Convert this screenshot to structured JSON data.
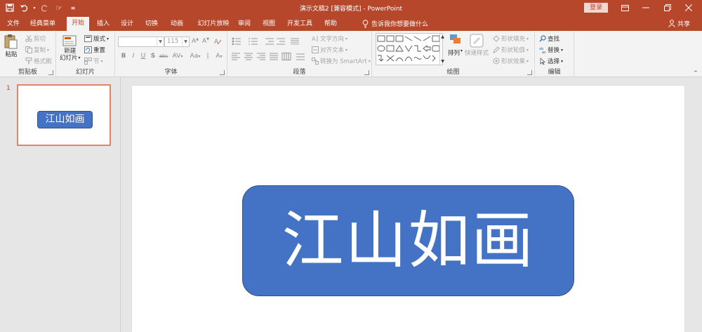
{
  "titlebar": {
    "doc_title": "演示文稿2 [兼容模式] - PowerPoint",
    "login": "登录",
    "qat_touch": "☞",
    "qat_more": "≡"
  },
  "tabs": [
    "文件",
    "经典菜单",
    "开始",
    "插入",
    "设计",
    "切换",
    "动画",
    "幻灯片放映",
    "审阅",
    "视图",
    "开发工具",
    "帮助"
  ],
  "tell_me": "告诉我你想要做什么",
  "share": "共享",
  "ribbon": {
    "clipboard": {
      "label": "剪贴板",
      "paste": "粘贴",
      "cut": "剪切",
      "copy": "复制",
      "format_painter": "格式刷"
    },
    "slides": {
      "label": "幻灯片",
      "new_slide_1": "新建",
      "new_slide_2": "幻灯片",
      "layout": "版式",
      "reset": "重置",
      "section": "节"
    },
    "font": {
      "label": "字体",
      "font_name": "",
      "font_size": "115"
    },
    "paragraph": {
      "label": "段落",
      "text_direction": "文字方向",
      "align_text": "对齐文本",
      "smartart": "转换为 SmartArt"
    },
    "drawing": {
      "label": "绘图",
      "arrange": "排列",
      "quick_styles": "快速样式",
      "shape_fill": "形状填充",
      "shape_outline": "形状轮廓",
      "shape_effects": "形状效果"
    },
    "editing": {
      "label": "编辑",
      "find": "查找",
      "replace": "替换",
      "select": "选择"
    }
  },
  "thumbnails": [
    {
      "number": "1",
      "text": "江山如画"
    }
  ],
  "slide": {
    "text": "江山如画"
  },
  "colors": {
    "accent": "#b7472a",
    "shape_fill": "#4472c4"
  }
}
